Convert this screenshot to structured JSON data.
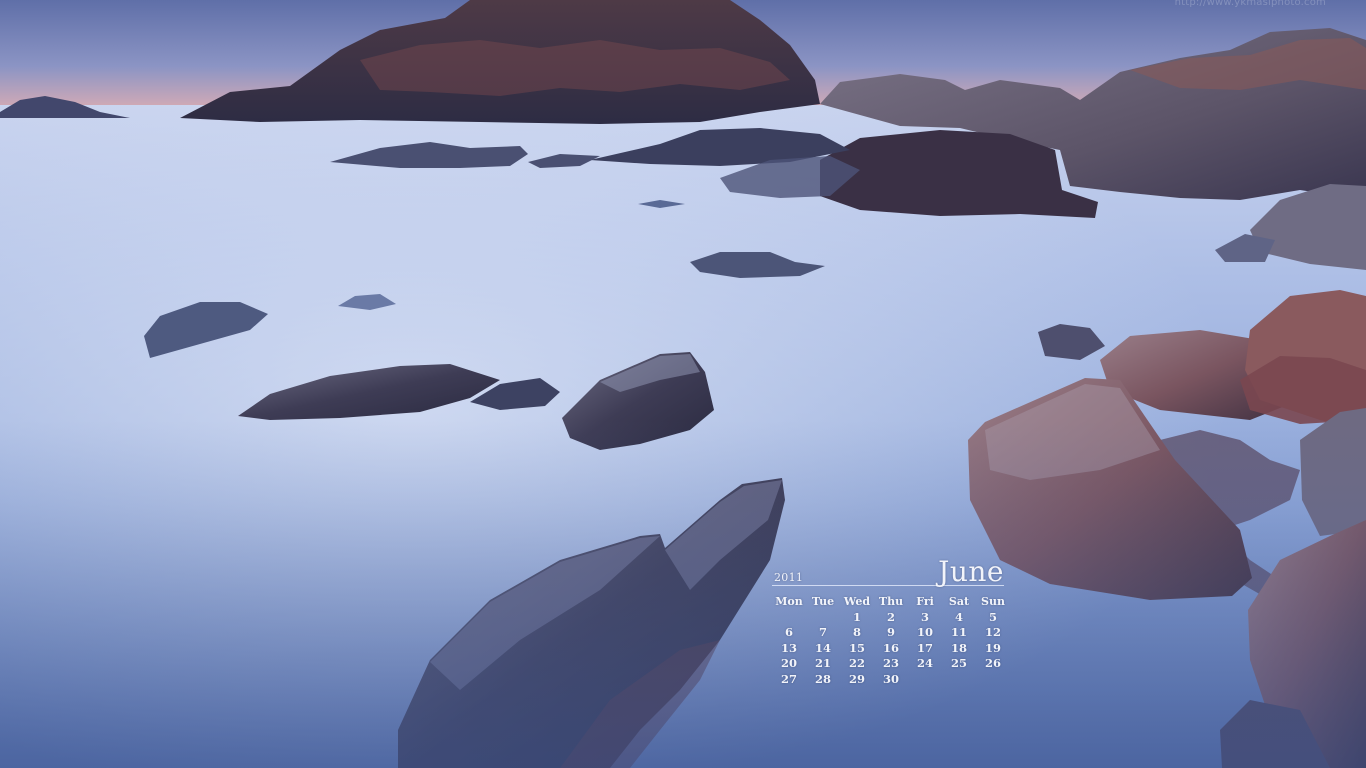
{
  "watermark": "http://www.ykmasiphoto.com",
  "calendar": {
    "year": "2011",
    "month": "June",
    "day_names": [
      "Mon",
      "Tue",
      "Wed",
      "Thu",
      "Fri",
      "Sat",
      "Sun"
    ],
    "weeks": [
      [
        "",
        "",
        "1",
        "2",
        "3",
        "4",
        "5"
      ],
      [
        "6",
        "7",
        "8",
        "9",
        "10",
        "11",
        "12"
      ],
      [
        "13",
        "14",
        "15",
        "16",
        "17",
        "18",
        "19"
      ],
      [
        "20",
        "21",
        "22",
        "23",
        "24",
        "25",
        "26"
      ],
      [
        "27",
        "28",
        "29",
        "30",
        "",
        "",
        ""
      ]
    ]
  },
  "colors": {
    "sky_top": "#6f7fb3",
    "horizon_glow": "#e8a9a0",
    "mist": "#c3cfea",
    "water_deep": "#5b73ad",
    "rock_dark": "#2e3149",
    "rock_red": "#7a4a4e"
  }
}
